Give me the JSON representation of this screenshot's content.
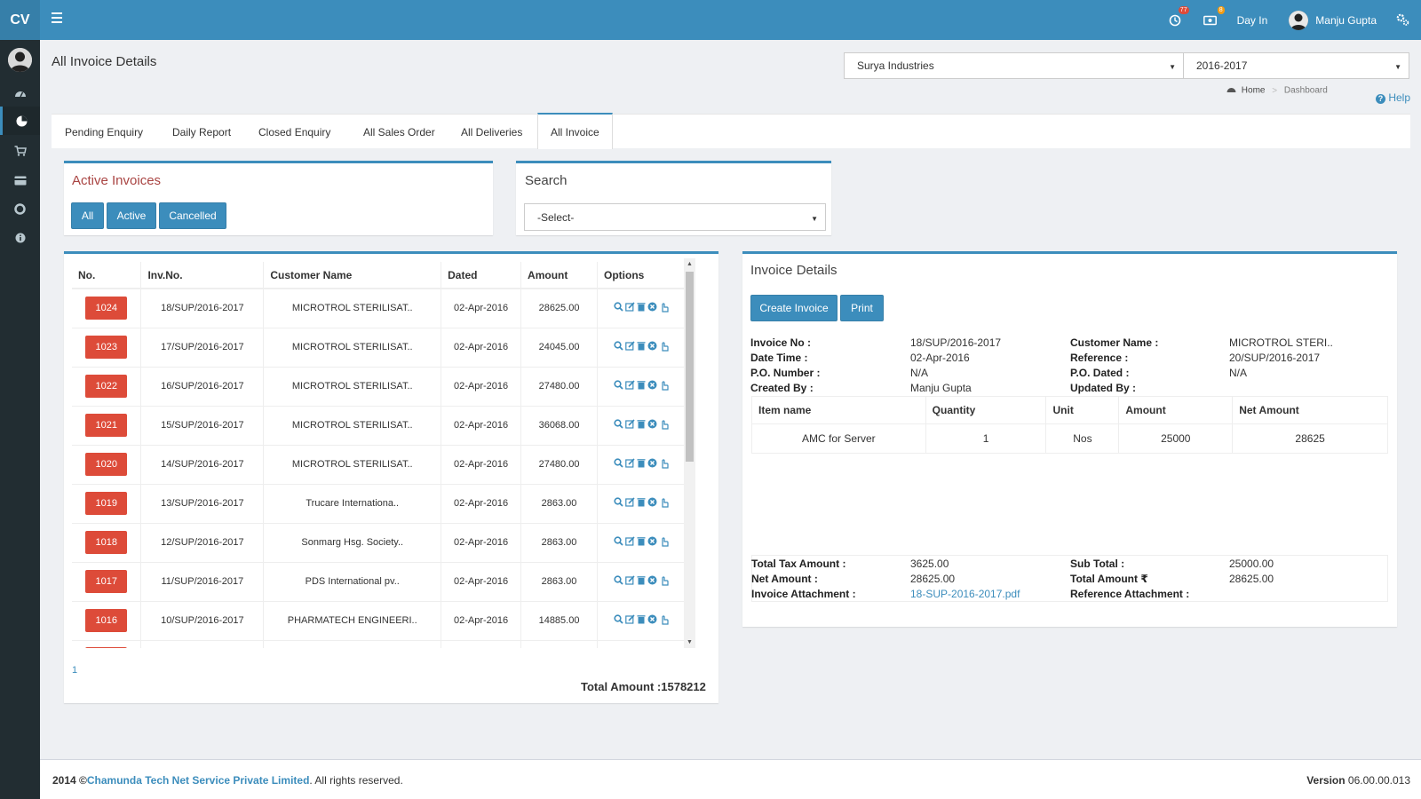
{
  "app": {
    "logo": "CV",
    "notifications": {
      "alerts_count": "77",
      "money_count": "8"
    },
    "day_in": "Day In",
    "user_name": "Manju Gupta"
  },
  "page": {
    "title": "All Invoice Details",
    "company_select": "Surya Industries",
    "year_select": "2016-2017",
    "breadcrumb_home": "Home",
    "breadcrumb_sep": ">",
    "breadcrumb_current": "Dashboard",
    "help": "Help"
  },
  "tabs": [
    {
      "label": "Pending Enquiry"
    },
    {
      "label": "Daily Report"
    },
    {
      "label": "Closed Enquiry"
    },
    {
      "label": "All Sales Order"
    },
    {
      "label": "All Deliveries"
    },
    {
      "label": "All Invoice"
    }
  ],
  "active_invoices": {
    "title": "Active Invoices",
    "buttons": [
      "All",
      "Active",
      "Cancelled"
    ]
  },
  "search": {
    "title": "Search",
    "select_value": "-Select-"
  },
  "invoice_table": {
    "headers": [
      "No.",
      "Inv.No.",
      "Customer Name",
      "Dated",
      "Amount",
      "Options"
    ],
    "rows": [
      {
        "no": "1024",
        "inv": "18/SUP/2016-2017",
        "customer": "MICROTROL STERILISAT..",
        "dated": "02-Apr-2016",
        "amount": "28625.00"
      },
      {
        "no": "1023",
        "inv": "17/SUP/2016-2017",
        "customer": "MICROTROL STERILISAT..",
        "dated": "02-Apr-2016",
        "amount": "24045.00"
      },
      {
        "no": "1022",
        "inv": "16/SUP/2016-2017",
        "customer": "MICROTROL STERILISAT..",
        "dated": "02-Apr-2016",
        "amount": "27480.00"
      },
      {
        "no": "1021",
        "inv": "15/SUP/2016-2017",
        "customer": "MICROTROL STERILISAT..",
        "dated": "02-Apr-2016",
        "amount": "36068.00"
      },
      {
        "no": "1020",
        "inv": "14/SUP/2016-2017",
        "customer": "MICROTROL STERILISAT..",
        "dated": "02-Apr-2016",
        "amount": "27480.00"
      },
      {
        "no": "1019",
        "inv": "13/SUP/2016-2017",
        "customer": "Trucare Internationa..",
        "dated": "02-Apr-2016",
        "amount": "2863.00"
      },
      {
        "no": "1018",
        "inv": "12/SUP/2016-2017",
        "customer": "Sonmarg Hsg. Society..",
        "dated": "02-Apr-2016",
        "amount": "2863.00"
      },
      {
        "no": "1017",
        "inv": "11/SUP/2016-2017",
        "customer": "PDS International pv..",
        "dated": "02-Apr-2016",
        "amount": "2863.00"
      },
      {
        "no": "1016",
        "inv": "10/SUP/2016-2017",
        "customer": "PHARMATECH ENGINEERI..",
        "dated": "02-Apr-2016",
        "amount": "14885.00"
      }
    ],
    "page_number": "1",
    "total_amount": "Total Amount :1578212"
  },
  "invoice_details": {
    "title": "Invoice Details",
    "create_button": "Create Invoice",
    "print_button": "Print",
    "fields": {
      "invoice_no_label": "Invoice No :",
      "invoice_no": "18/SUP/2016-2017",
      "date_time_label": "Date Time :",
      "date_time": "02-Apr-2016",
      "po_number_label": "P.O. Number :",
      "po_number": "N/A",
      "created_by_label": "Created By :",
      "created_by": "Manju Gupta",
      "customer_name_label": "Customer Name :",
      "customer_name": "MICROTROL STERI..",
      "reference_label": "Reference :",
      "reference": "20/SUP/2016-2017",
      "po_dated_label": "P.O. Dated :",
      "po_dated": "N/A",
      "updated_by_label": "Updated By :",
      "updated_by": ""
    },
    "items_headers": [
      "Item name",
      "Quantity",
      "Unit",
      "Amount",
      "Net Amount"
    ],
    "items": [
      {
        "name": "AMC for Server",
        "quantity": "1",
        "unit": "Nos",
        "amount": "25000",
        "net_amount": "28625"
      }
    ],
    "totals": {
      "total_tax_label": "Total Tax Amount :",
      "total_tax": "3625.00",
      "net_amount_label": "Net Amount :",
      "net_amount": "28625.00",
      "attachment_label": "Invoice Attachment :",
      "attachment": "18-SUP-2016-2017.pdf",
      "sub_total_label": "Sub Total :",
      "sub_total": "25000.00",
      "total_amount_label": "Total Amount ₹",
      "total_amount": "28625.00",
      "ref_attachment_label": "Reference Attachment :",
      "ref_attachment": ""
    }
  },
  "footer": {
    "year": "2014 ©",
    "company": "Chamunda Tech Net Service Private Limited",
    "rights": ". All rights reserved.",
    "version_label": "Version",
    "version": "06.00.00.013"
  },
  "colors": {
    "primary": "#3c8dbc",
    "danger": "#dd4b39",
    "sidebar": "#222d32"
  }
}
